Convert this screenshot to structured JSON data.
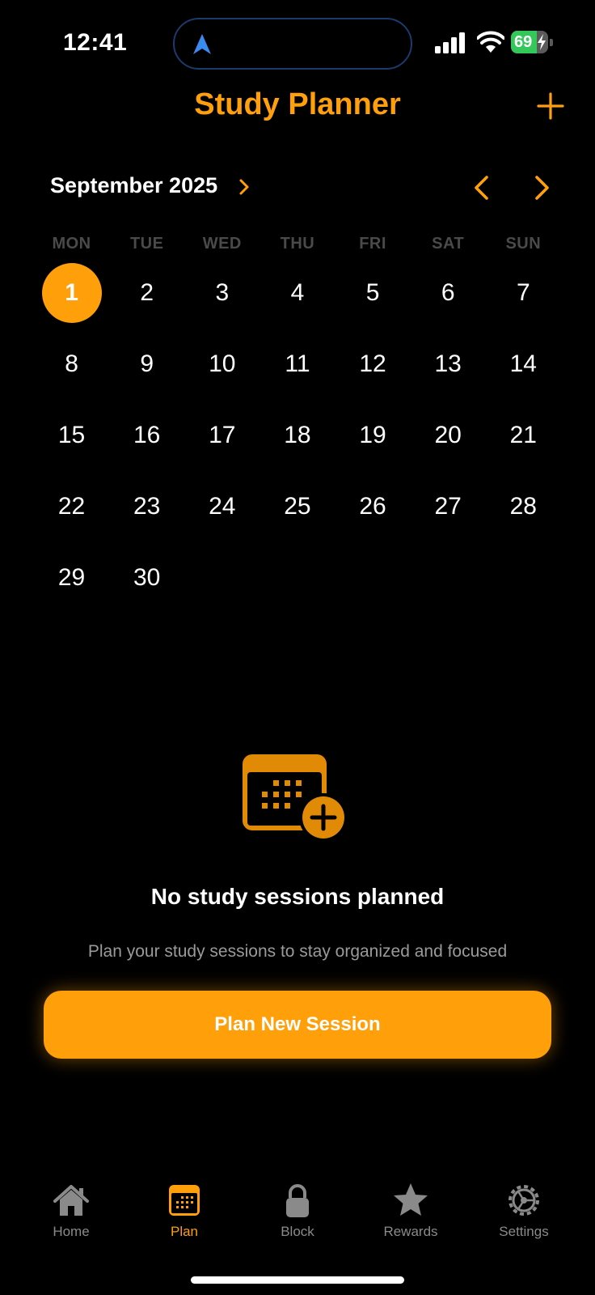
{
  "status_bar": {
    "time": "12:41",
    "battery_level": "69",
    "battery_fraction": 0.69,
    "icons": [
      "location-arrow-icon",
      "cellular-signal-icon",
      "wifi-icon",
      "battery-charging-icon"
    ]
  },
  "header": {
    "title": "Study Planner",
    "add_icon": "plus-icon"
  },
  "calendar": {
    "month_label": "September 2025",
    "weekdays": [
      "MON",
      "TUE",
      "WED",
      "THU",
      "FRI",
      "SAT",
      "SUN"
    ],
    "days": [
      "1",
      "2",
      "3",
      "4",
      "5",
      "6",
      "7",
      "8",
      "9",
      "10",
      "11",
      "12",
      "13",
      "14",
      "15",
      "16",
      "17",
      "18",
      "19",
      "20",
      "21",
      "22",
      "23",
      "24",
      "25",
      "26",
      "27",
      "28",
      "29",
      "30"
    ],
    "selected_day": "1"
  },
  "empty_state": {
    "icon": "calendar-add-icon",
    "title": "No study sessions planned",
    "subtitle": "Plan your study sessions to stay organized and focused",
    "button_label": "Plan New Session"
  },
  "tab_bar": {
    "tabs": [
      {
        "label": "Home",
        "icon": "home-icon",
        "active": false
      },
      {
        "label": "Plan",
        "icon": "calendar-icon",
        "active": true
      },
      {
        "label": "Block",
        "icon": "lock-icon",
        "active": false
      },
      {
        "label": "Rewards",
        "icon": "star-icon",
        "active": false
      },
      {
        "label": "Settings",
        "icon": "gear-icon",
        "active": false
      }
    ]
  },
  "colors": {
    "accent": "#ff9f0a",
    "background": "#000000",
    "battery_green": "#34c759",
    "inactive_tab": "#8a8a8a"
  }
}
